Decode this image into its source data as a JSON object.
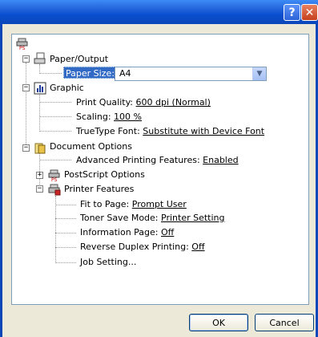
{
  "window": {
    "help_glyph": "?",
    "close_glyph": "✕"
  },
  "tree": {
    "root_icon": "postscript-printer-icon",
    "paper_output": {
      "label": "Paper/Output",
      "paper_size_label": "Paper Size:",
      "paper_size_value": "A4"
    },
    "graphic": {
      "label": "Graphic",
      "print_quality_label": "Print Quality: ",
      "print_quality_value": "600 dpi (Normal)",
      "scaling_label": "Scaling: ",
      "scaling_value": "100 %",
      "truetype_label": "TrueType Font: ",
      "truetype_value": "Substitute with Device Font"
    },
    "document_options": {
      "label": "Document Options",
      "advanced_label": "Advanced Printing Features: ",
      "advanced_value": "Enabled",
      "postscript_label": "PostScript Options",
      "printer_features": {
        "label": "Printer Features",
        "fit_label": "Fit to Page: ",
        "fit_value": "Prompt User",
        "toner_label": "Toner Save Mode: ",
        "toner_value": "Printer Setting",
        "info_label": "Information Page: ",
        "info_value": "Off",
        "duplex_label": "Reverse Duplex Printing: ",
        "duplex_value": "Off",
        "job_label": "Job Setting..."
      }
    }
  },
  "buttons": {
    "ok": "OK",
    "cancel": "Cancel"
  }
}
